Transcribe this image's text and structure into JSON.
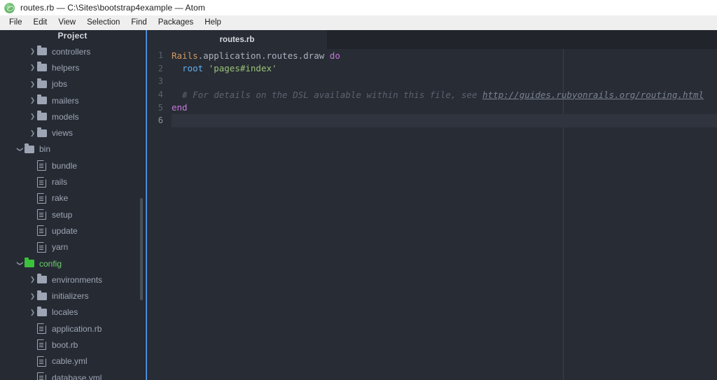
{
  "window": {
    "logo_icon": "atom-logo-icon",
    "title": "routes.rb — C:\\Sites\\bootstrap4example — Atom"
  },
  "menubar": {
    "items": [
      {
        "label": "File"
      },
      {
        "label": "Edit"
      },
      {
        "label": "View"
      },
      {
        "label": "Selection"
      },
      {
        "label": "Find"
      },
      {
        "label": "Packages"
      },
      {
        "label": "Help"
      }
    ]
  },
  "sidebar": {
    "title": "Project",
    "scrollbar": "vertical-scrollbar",
    "tree": [
      {
        "label": "controllers",
        "type": "folder",
        "depth": 1,
        "state": "collapsed",
        "twisty": "❯",
        "modified": false
      },
      {
        "label": "helpers",
        "type": "folder",
        "depth": 1,
        "state": "collapsed",
        "twisty": "❯",
        "modified": false
      },
      {
        "label": "jobs",
        "type": "folder",
        "depth": 1,
        "state": "collapsed",
        "twisty": "❯",
        "modified": false
      },
      {
        "label": "mailers",
        "type": "folder",
        "depth": 1,
        "state": "collapsed",
        "twisty": "❯",
        "modified": false
      },
      {
        "label": "models",
        "type": "folder",
        "depth": 1,
        "state": "collapsed",
        "twisty": "❯",
        "modified": false
      },
      {
        "label": "views",
        "type": "folder",
        "depth": 1,
        "state": "collapsed",
        "twisty": "❯",
        "modified": false
      },
      {
        "label": "bin",
        "type": "folder",
        "depth": 0,
        "state": "expanded",
        "twisty": "❯",
        "modified": false
      },
      {
        "label": "bundle",
        "type": "file",
        "depth": 1,
        "state": "leaf",
        "twisty": "",
        "modified": false
      },
      {
        "label": "rails",
        "type": "file",
        "depth": 1,
        "state": "leaf",
        "twisty": "",
        "modified": false
      },
      {
        "label": "rake",
        "type": "file",
        "depth": 1,
        "state": "leaf",
        "twisty": "",
        "modified": false
      },
      {
        "label": "setup",
        "type": "file",
        "depth": 1,
        "state": "leaf",
        "twisty": "",
        "modified": false
      },
      {
        "label": "update",
        "type": "file",
        "depth": 1,
        "state": "leaf",
        "twisty": "",
        "modified": false
      },
      {
        "label": "yarn",
        "type": "file",
        "depth": 1,
        "state": "leaf",
        "twisty": "",
        "modified": false
      },
      {
        "label": "config",
        "type": "folder",
        "depth": 0,
        "state": "expanded",
        "twisty": "❯",
        "modified": true
      },
      {
        "label": "environments",
        "type": "folder",
        "depth": 1,
        "state": "collapsed",
        "twisty": "❯",
        "modified": false
      },
      {
        "label": "initializers",
        "type": "folder",
        "depth": 1,
        "state": "collapsed",
        "twisty": "❯",
        "modified": false
      },
      {
        "label": "locales",
        "type": "folder",
        "depth": 1,
        "state": "collapsed",
        "twisty": "❯",
        "modified": false
      },
      {
        "label": "application.rb",
        "type": "file",
        "depth": 1,
        "state": "leaf",
        "twisty": "",
        "modified": false
      },
      {
        "label": "boot.rb",
        "type": "file",
        "depth": 1,
        "state": "leaf",
        "twisty": "",
        "modified": false
      },
      {
        "label": "cable.yml",
        "type": "file",
        "depth": 1,
        "state": "leaf",
        "twisty": "",
        "modified": false
      },
      {
        "label": "database.yml",
        "type": "file",
        "depth": 1,
        "state": "leaf",
        "twisty": "",
        "modified": false
      }
    ]
  },
  "editor": {
    "tabs": [
      {
        "label": "routes.rb",
        "active": true
      }
    ],
    "cursor_line": 6,
    "lines": [
      {
        "number": "1",
        "tokens": [
          {
            "text": "Rails",
            "cls": "tk-const"
          },
          {
            "text": ".application.routes.draw ",
            "cls": "tk-plain"
          },
          {
            "text": "do",
            "cls": "tk-kw"
          }
        ]
      },
      {
        "number": "2",
        "tokens": [
          {
            "text": "  ",
            "cls": "tk-plain"
          },
          {
            "text": "root",
            "cls": "tk-fn"
          },
          {
            "text": " ",
            "cls": "tk-plain"
          },
          {
            "text": "'pages#index'",
            "cls": "tk-str"
          }
        ]
      },
      {
        "number": "3",
        "tokens": []
      },
      {
        "number": "4",
        "tokens": [
          {
            "text": "  # For details on the DSL available within this file, see ",
            "cls": "tk-comment"
          },
          {
            "text": "http://guides.rubyonrails.org/routing.html",
            "cls": "tk-link"
          }
        ]
      },
      {
        "number": "5",
        "tokens": [
          {
            "text": "end",
            "cls": "tk-kw"
          }
        ]
      },
      {
        "number": "6",
        "tokens": []
      }
    ]
  },
  "colors": {
    "titlebar_bg": "#ffffff",
    "menubar_bg": "#efefef",
    "sidebar_bg": "#262b33",
    "editor_bg": "#282c34",
    "tabbar_bg": "#21252b",
    "accent_blue": "#4a8fe0",
    "modified_green": "#3cc23c",
    "text_muted": "#9da5b4",
    "syntax_constant": "#d19a66",
    "syntax_keyword": "#c678dd",
    "syntax_function": "#61afef",
    "syntax_string": "#98c379",
    "syntax_comment": "#5c6370"
  }
}
